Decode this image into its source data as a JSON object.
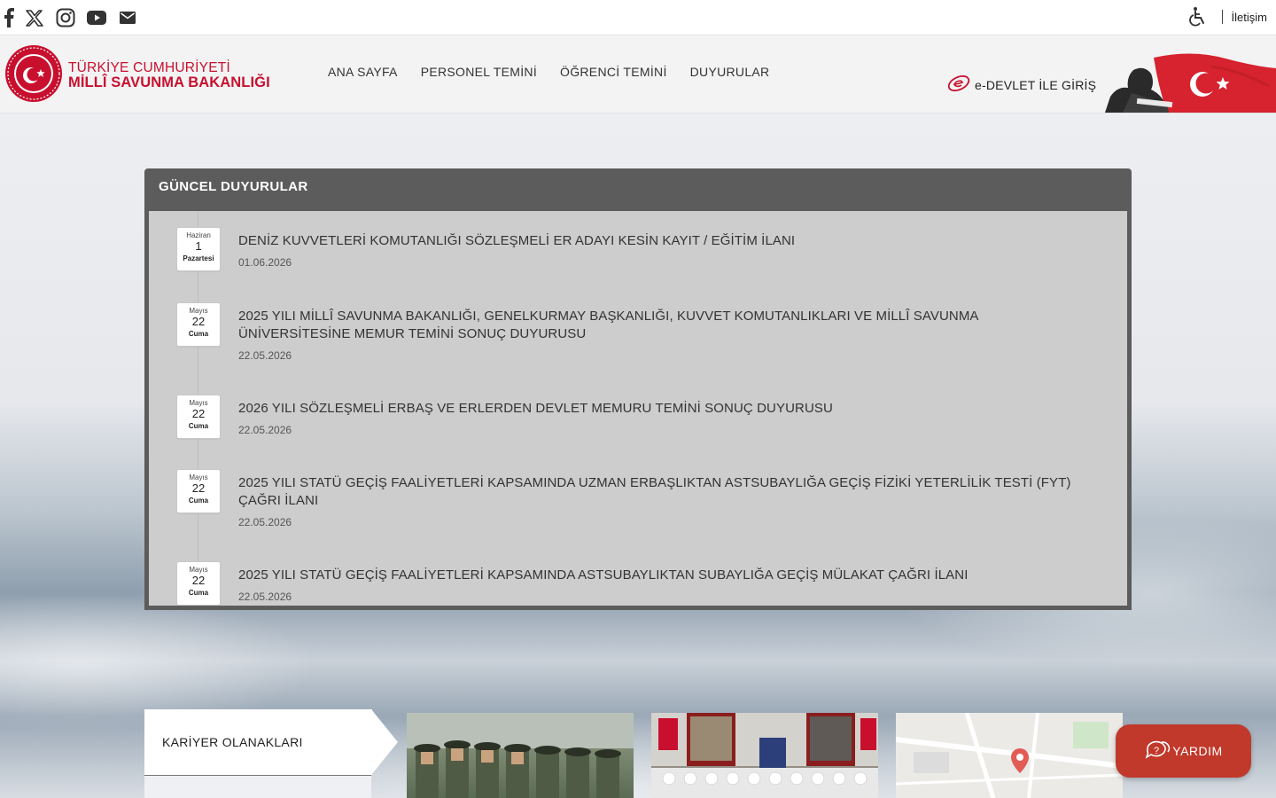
{
  "topbar": {
    "social_icons": [
      "facebook-icon",
      "x-twitter-icon",
      "instagram-icon",
      "youtube-icon",
      "mail-icon"
    ],
    "contact_label": "İletişim"
  },
  "header": {
    "logo_line1": "TÜRKİYE CUMHURİYETİ",
    "logo_line2": "MİLLÎ SAVUNMA BAKANLIĞI",
    "nav": [
      "ANA SAYFA",
      "PERSONEL TEMİNİ",
      "ÖĞRENCİ TEMİNİ",
      "DUYURULAR"
    ],
    "edevlet_label": "e-DEVLET İLE GİRİŞ"
  },
  "announcements": {
    "title": "GÜNCEL DUYURULAR",
    "items": [
      {
        "month": "Haziran",
        "day": "1",
        "weekday": "Pazartesi",
        "title": "DENİZ KUVVETLERİ KOMUTANLIĞI SÖZLEŞMELİ ER ADAYI KESİN KAYIT / EĞİTİM İLANI",
        "date": "01.06.2026"
      },
      {
        "month": "Mayıs",
        "day": "22",
        "weekday": "Cuma",
        "title": "2025 YILI MİLLÎ SAVUNMA BAKANLIĞI, GENELKURMAY BAŞKANLIĞI, KUVVET KOMUTANLIKLARI VE MİLLÎ SAVUNMA ÜNİVERSİTESİNE MEMUR TEMİNİ SONUÇ DUYURUSU",
        "date": "22.05.2026"
      },
      {
        "month": "Mayıs",
        "day": "22",
        "weekday": "Cuma",
        "title": "2026 YILI SÖZLEŞMELİ ERBAŞ VE ERLERDEN DEVLET MEMURU TEMİNİ SONUÇ DUYURUSU",
        "date": "22.05.2026"
      },
      {
        "month": "Mayıs",
        "day": "22",
        "weekday": "Cuma",
        "title": "2025 YILI STATÜ GEÇİŞ FAALİYETLERİ KAPSAMINDA UZMAN ERBAŞLIKTAN ASTSUBAYLIĞA GEÇİŞ FİZİKİ YETERLİLİK TESTİ (FYT) ÇAĞRI İLANI",
        "date": "22.05.2026"
      },
      {
        "month": "Mayıs",
        "day": "22",
        "weekday": "Cuma",
        "title": "2025 YILI STATÜ GEÇİŞ FAALİYETLERİ KAPSAMINDA ASTSUBAYLIKTAN SUBAYLIĞA GEÇİŞ MÜLAKAT ÇAĞRI İLANI",
        "date": "22.05.2026"
      }
    ]
  },
  "bottom": {
    "career_label": "KARİYER OLANAKLARI"
  },
  "help": {
    "label": "YARDIM"
  }
}
